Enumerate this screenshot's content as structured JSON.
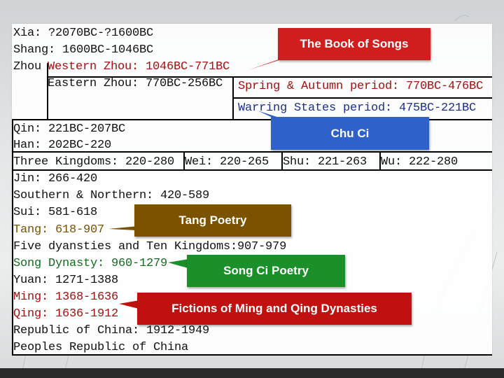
{
  "dynasties": {
    "xia": "Xia: ?2070BC-?1600BC",
    "shang": "Shang: 1600BC-1046BC",
    "zhou_label": "Zhou",
    "western_zhou": "Western Zhou: 1046BC-771BC",
    "eastern_zhou": "Eastern Zhou: 770BC-256BC",
    "spring_autumn": "Spring & Autumn period: 770BC-476BC",
    "warring_states": "Warring States period: 475BC-221BC",
    "qin": "Qin: 221BC-207BC",
    "han": "Han: 202BC-220",
    "three_kingdoms": "Three Kingdoms: 220-280",
    "wei": "Wei: 220-265",
    "shu": "Shu: 221-263",
    "wu": "Wu: 222-280",
    "jin": "Jin: 266-420",
    "southern_northern": "Southern & Northern: 420-589",
    "sui": "Sui: 581-618",
    "tang": "Tang: 618-907",
    "five_dynasties": "Five dyansties and Ten Kingdoms:907-979",
    "song": "Song Dynasty: 960-1279",
    "yuan": "Yuan: 1271-1388",
    "ming": "Ming: 1368-1636",
    "qing": "Qing: 1636-1912",
    "republic": "Republic of China: 1912-1949",
    "prc": "Peoples Republic of China"
  },
  "callouts": {
    "book_of_songs": "The Book of Songs",
    "chu_ci": "Chu Ci",
    "tang_poetry": "Tang Poetry",
    "song_ci": "Song Ci Poetry",
    "ming_qing": "Fictions of Ming and Qing Dynasties"
  },
  "colors": {
    "red_text": "#a51010",
    "green_text": "#0f6e1c",
    "blue_text": "#1c2f8c",
    "book_of_songs_box": "#d11d1d",
    "chu_ci_box": "#2e62c9",
    "tang_box": "#7a5200",
    "song_box": "#1a8f2a",
    "ming_qing_box": "#c01010"
  }
}
